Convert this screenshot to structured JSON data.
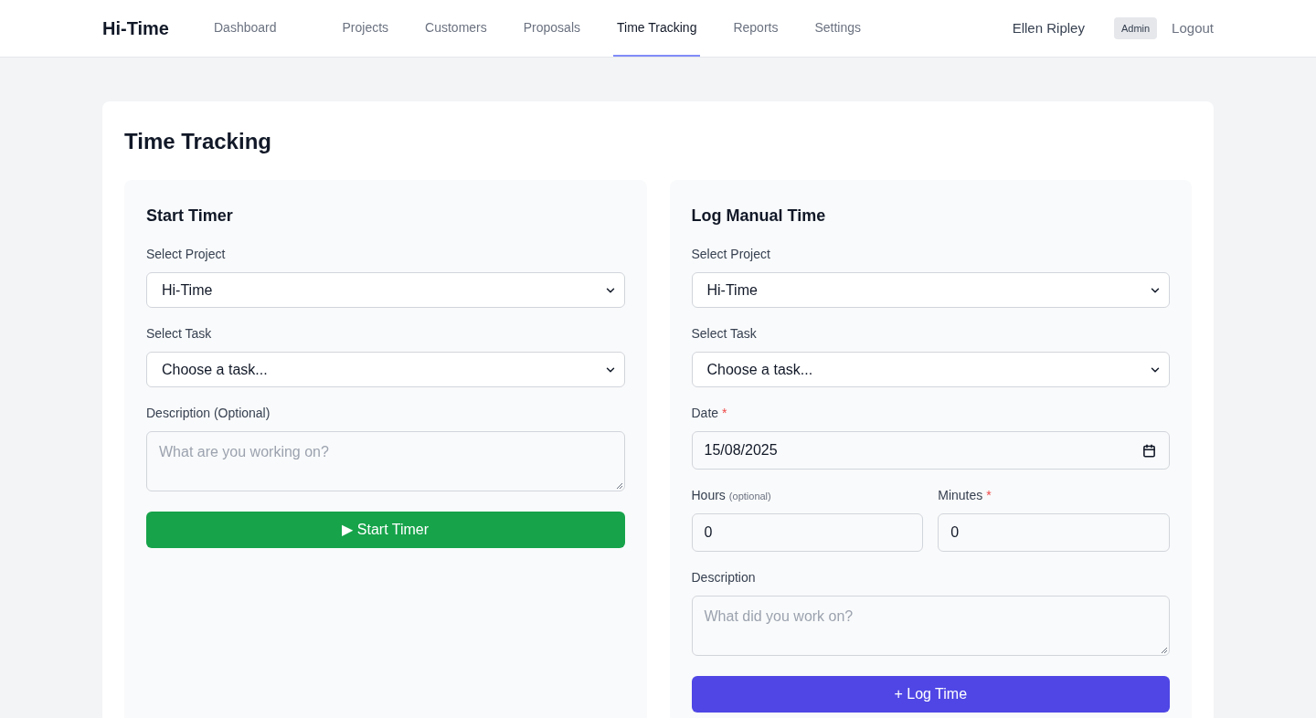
{
  "header": {
    "logo": "Hi-Time",
    "nav": [
      {
        "label": "Dashboard",
        "selected": false
      },
      {
        "label": "Projects",
        "selected": false
      },
      {
        "label": "Customers",
        "selected": false
      },
      {
        "label": "Proposals",
        "selected": false
      },
      {
        "label": "Time Tracking",
        "selected": true
      },
      {
        "label": "Reports",
        "selected": false
      },
      {
        "label": "Settings",
        "selected": false
      }
    ],
    "user": "Ellen Ripley",
    "role_badge": "Admin",
    "logout": "Logout"
  },
  "page_title": "Time Tracking",
  "panels": [
    {
      "title": "Start Timer",
      "fields": [
        {
          "kind": "select",
          "label": "Select Project",
          "value": "Hi-Time"
        },
        {
          "kind": "select",
          "label": "Select Task",
          "value": "Choose a task..."
        },
        {
          "kind": "textarea",
          "label": "Description (Optional)",
          "placeholder": "What are you working on?"
        }
      ],
      "button": {
        "label": "▶ Start Timer",
        "kind": "green"
      }
    },
    {
      "title": "Log Manual Time",
      "fields": [
        {
          "kind": "select",
          "label": "Select Project",
          "value": "Hi-Time"
        },
        {
          "kind": "select",
          "label": "Select Task",
          "value": "Choose a task..."
        },
        {
          "kind": "date",
          "label": "Date",
          "required_mark": "*",
          "value": "15/08/2025"
        },
        {
          "kind": "pair",
          "items": [
            {
              "label": "Hours",
              "hint": "(optional)",
              "value": "0"
            },
            {
              "label": "Minutes",
              "required_mark": "*",
              "value": "0"
            }
          ]
        },
        {
          "kind": "textarea",
          "label": "Description",
          "placeholder": "What did you work on?"
        }
      ],
      "button": {
        "label": "+ Log Time",
        "kind": "indigo"
      }
    }
  ]
}
